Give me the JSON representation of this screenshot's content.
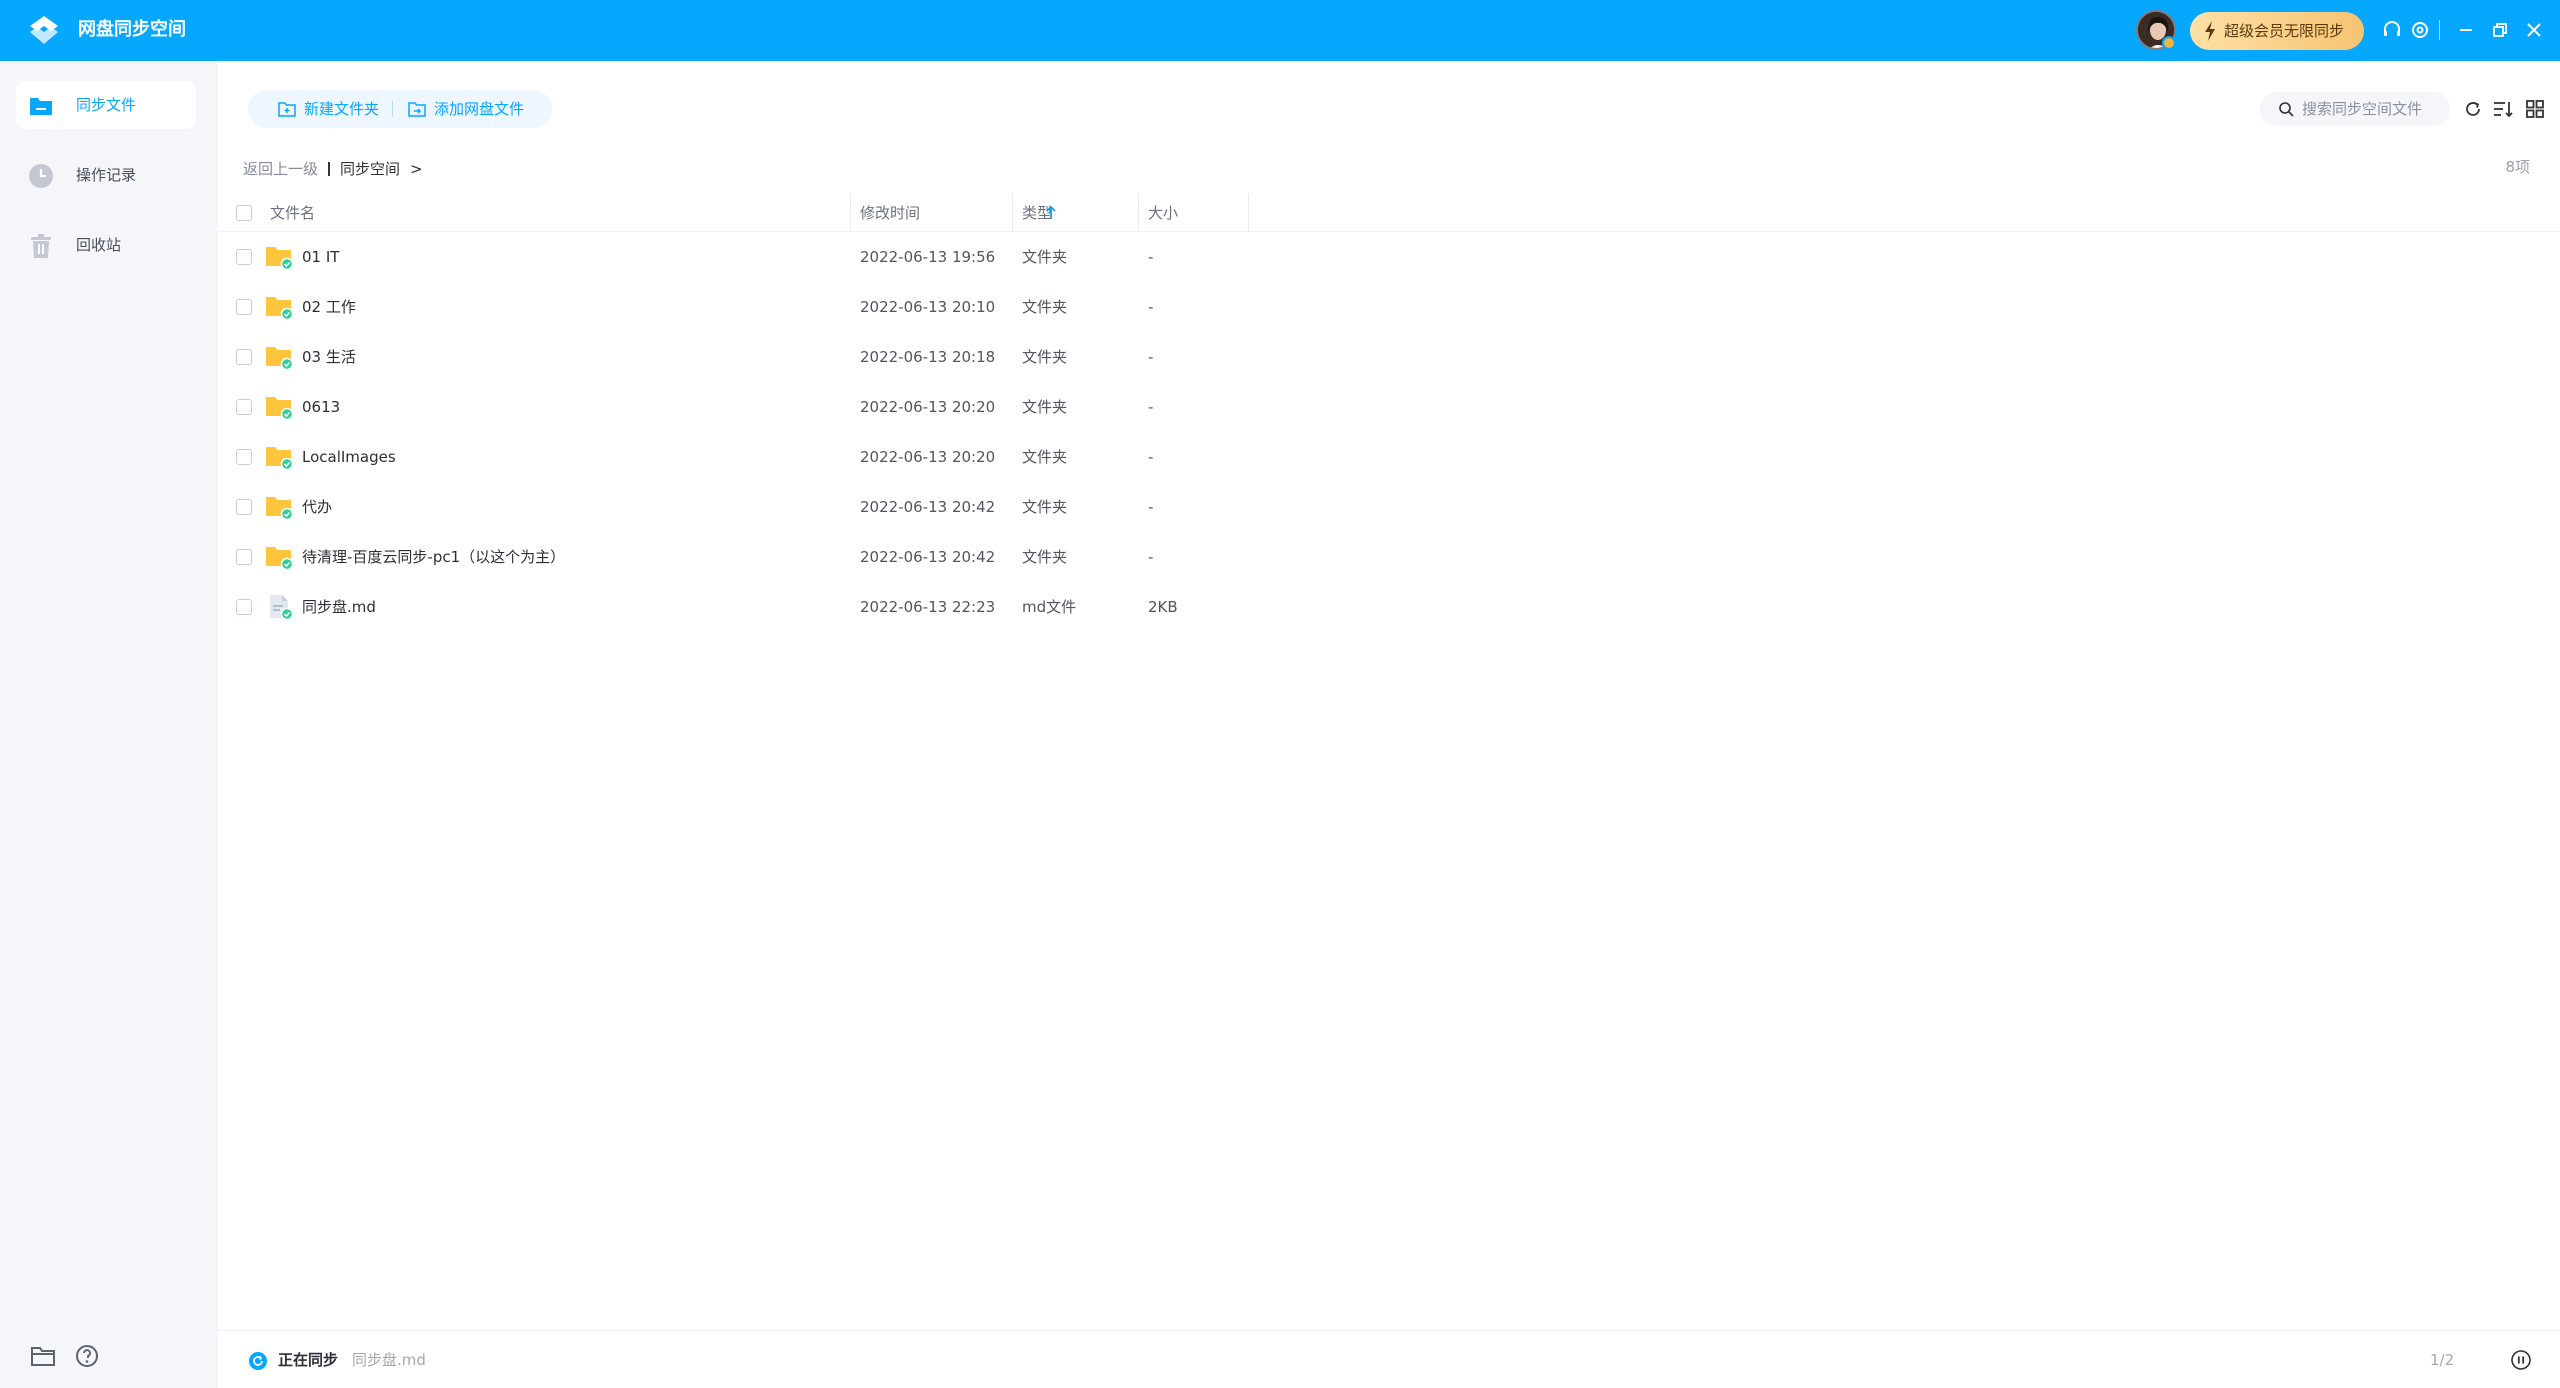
{
  "app": {
    "title": "网盘同步空间"
  },
  "header": {
    "vip_label": "超级会员无限同步"
  },
  "sidebar": {
    "items": [
      {
        "label": "同步文件"
      },
      {
        "label": "操作记录"
      },
      {
        "label": "回收站"
      }
    ]
  },
  "toolbar": {
    "new_folder_label": "新建文件夹",
    "add_cloud_file_label": "添加网盘文件",
    "search_placeholder": "搜索同步空间文件"
  },
  "breadcrumb": {
    "back_label": "返回上一级",
    "current": "同步空间",
    "chevron": ">"
  },
  "item_count": "8项",
  "table": {
    "headers": {
      "name": "文件名",
      "mtime": "修改时间",
      "type": "类型",
      "size": "大小"
    },
    "rows": [
      {
        "name": "01 IT",
        "mtime": "2022-06-13 19:56",
        "type": "文件夹",
        "size": "-",
        "icon": "folder-synced-icon"
      },
      {
        "name": "02 工作",
        "mtime": "2022-06-13 20:10",
        "type": "文件夹",
        "size": "-",
        "icon": "folder-synced-icon"
      },
      {
        "name": "03 生活",
        "mtime": "2022-06-13 20:18",
        "type": "文件夹",
        "size": "-",
        "icon": "folder-synced-icon"
      },
      {
        "name": "0613",
        "mtime": "2022-06-13 20:20",
        "type": "文件夹",
        "size": "-",
        "icon": "folder-synced-icon"
      },
      {
        "name": "LocalImages",
        "mtime": "2022-06-13 20:20",
        "type": "文件夹",
        "size": "-",
        "icon": "folder-synced-icon"
      },
      {
        "name": "代办",
        "mtime": "2022-06-13 20:42",
        "type": "文件夹",
        "size": "-",
        "icon": "folder-synced-icon"
      },
      {
        "name": "待清理-百度云同步-pc1（以这个为主）",
        "mtime": "2022-06-13 20:42",
        "type": "文件夹",
        "size": "-",
        "icon": "folder-synced-icon"
      },
      {
        "name": "同步盘.md",
        "mtime": "2022-06-13 22:23",
        "type": "md文件",
        "size": "2KB",
        "icon": "file-synced-icon"
      }
    ]
  },
  "status": {
    "sync_label": "正在同步",
    "sync_file": "同步盘.md",
    "page": "1/2"
  },
  "colors": {
    "brand": "#06a7ff",
    "sidebar_bg": "#f4f6fa",
    "folder": "#ffc63d",
    "sync_ok": "#2bd196",
    "vip": "#f6c472"
  }
}
